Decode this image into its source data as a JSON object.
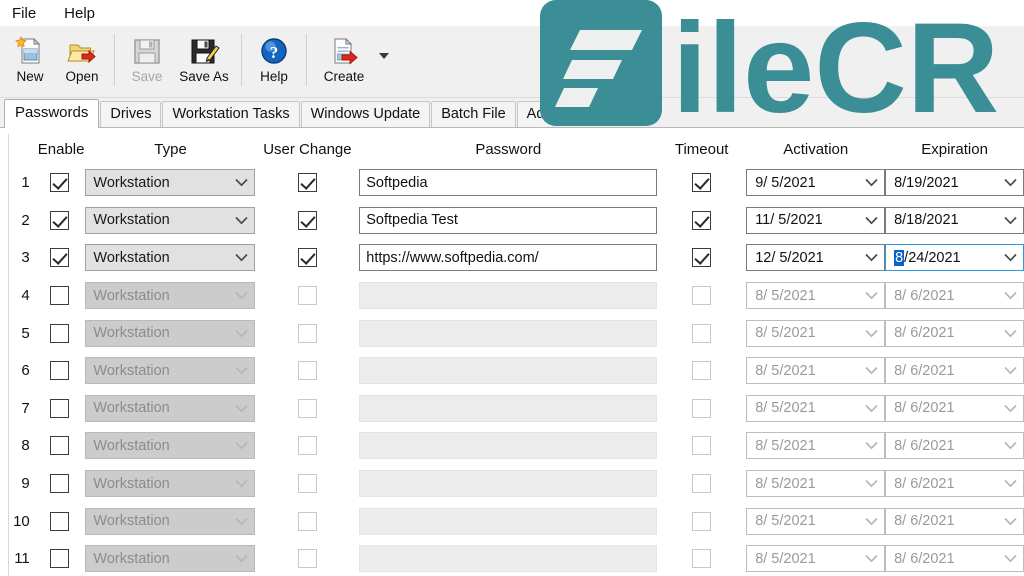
{
  "window": {
    "menu": [
      {
        "label": "File"
      },
      {
        "label": "Help"
      }
    ]
  },
  "toolbar": {
    "buttons": [
      {
        "label": "New",
        "icon": "new-document-icon",
        "enabled": true
      },
      {
        "label": "Open",
        "icon": "open-folder-icon",
        "enabled": true
      },
      {
        "label": "Save",
        "icon": "floppy-disk-icon",
        "enabled": false
      },
      {
        "label": "Save As",
        "icon": "floppy-disk-pencil-icon",
        "enabled": true
      },
      {
        "label": "Help",
        "icon": "question-mark-icon",
        "enabled": true
      },
      {
        "label": "Create",
        "icon": "document-arrow-icon",
        "enabled": true
      }
    ],
    "dropdown_icon": "chevron-down-icon"
  },
  "tabs": [
    {
      "label": "Passwords",
      "active": true
    },
    {
      "label": "Drives",
      "active": false
    },
    {
      "label": "Workstation Tasks",
      "active": false
    },
    {
      "label": "Windows Update",
      "active": false
    },
    {
      "label": "Batch File",
      "active": false
    },
    {
      "label": "Ad",
      "active": false
    }
  ],
  "grid": {
    "headers": [
      "Enable",
      "Type",
      "User Change",
      "Password",
      "Timeout",
      "Activation",
      "Expiration"
    ],
    "rows": [
      {
        "num": "1",
        "enable": true,
        "type": "Workstation",
        "user_change": true,
        "password": "Softpedia",
        "timeout": true,
        "activation": "9/ 5/2021",
        "expiration": "8/19/2021",
        "enabled": true,
        "focused": false
      },
      {
        "num": "2",
        "enable": true,
        "type": "Workstation",
        "user_change": true,
        "password": "Softpedia Test",
        "timeout": true,
        "activation": "11/ 5/2021",
        "expiration": "8/18/2021",
        "enabled": true,
        "focused": false
      },
      {
        "num": "3",
        "enable": true,
        "type": "Workstation",
        "user_change": true,
        "password": "https://www.softpedia.com/",
        "timeout": true,
        "activation": "12/ 5/2021",
        "expiration": "8/24/2021",
        "enabled": true,
        "focused": true,
        "expiration_selected_part": "8",
        "expiration_rest": "/24/2021"
      },
      {
        "num": "4",
        "enable": false,
        "type": "Workstation",
        "user_change": false,
        "password": "",
        "timeout": false,
        "activation": "8/ 5/2021",
        "expiration": "8/ 6/2021",
        "enabled": false,
        "focused": false
      },
      {
        "num": "5",
        "enable": false,
        "type": "Workstation",
        "user_change": false,
        "password": "",
        "timeout": false,
        "activation": "8/ 5/2021",
        "expiration": "8/ 6/2021",
        "enabled": false,
        "focused": false
      },
      {
        "num": "6",
        "enable": false,
        "type": "Workstation",
        "user_change": false,
        "password": "",
        "timeout": false,
        "activation": "8/ 5/2021",
        "expiration": "8/ 6/2021",
        "enabled": false,
        "focused": false
      },
      {
        "num": "7",
        "enable": false,
        "type": "Workstation",
        "user_change": false,
        "password": "",
        "timeout": false,
        "activation": "8/ 5/2021",
        "expiration": "8/ 6/2021",
        "enabled": false,
        "focused": false
      },
      {
        "num": "8",
        "enable": false,
        "type": "Workstation",
        "user_change": false,
        "password": "",
        "timeout": false,
        "activation": "8/ 5/2021",
        "expiration": "8/ 6/2021",
        "enabled": false,
        "focused": false
      },
      {
        "num": "9",
        "enable": false,
        "type": "Workstation",
        "user_change": false,
        "password": "",
        "timeout": false,
        "activation": "8/ 5/2021",
        "expiration": "8/ 6/2021",
        "enabled": false,
        "focused": false
      },
      {
        "num": "10",
        "enable": false,
        "type": "Workstation",
        "user_change": false,
        "password": "",
        "timeout": false,
        "activation": "8/ 5/2021",
        "expiration": "8/ 6/2021",
        "enabled": false,
        "focused": false
      },
      {
        "num": "11",
        "enable": false,
        "type": "Workstation",
        "user_change": false,
        "password": "",
        "timeout": false,
        "activation": "8/ 5/2021",
        "expiration": "8/ 6/2021",
        "enabled": false,
        "focused": false
      }
    ]
  },
  "watermark": {
    "text": "ileCR",
    "mark_icon": "filecr-f-logo-icon",
    "color": "#3c8e96"
  }
}
